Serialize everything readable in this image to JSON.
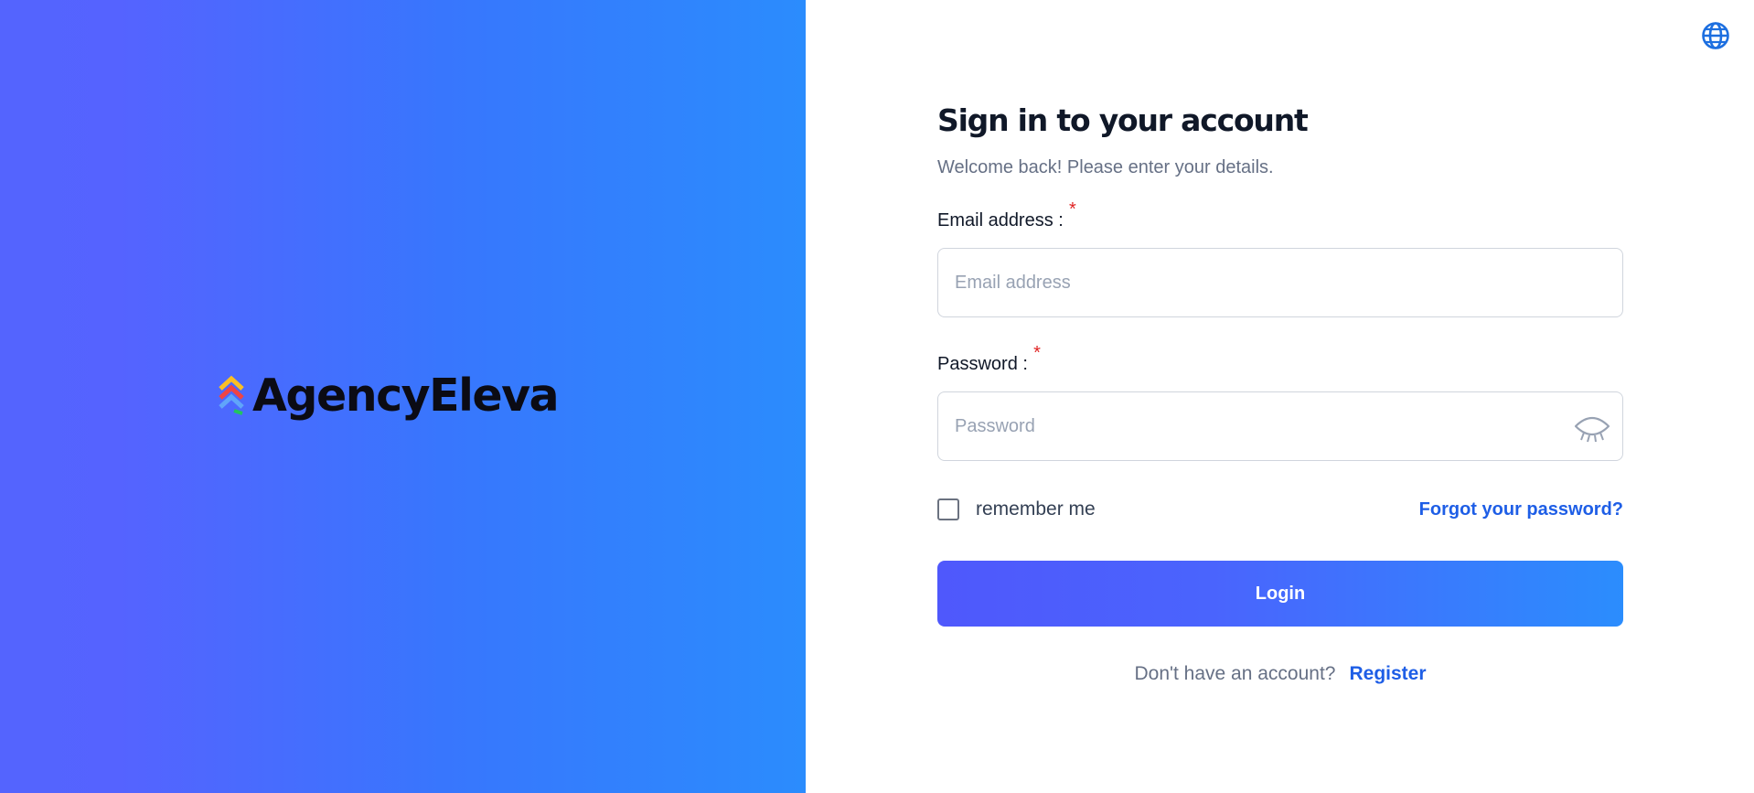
{
  "brand": {
    "name": "AgencyEleva",
    "logo_icon": "stacked-chevrons-logo",
    "logo_colors": [
      "#fbbf24",
      "#ef4444",
      "#60a5fa",
      "#22c55e"
    ]
  },
  "language": {
    "icon": "globe-icon"
  },
  "form": {
    "title": "Sign in to your account",
    "subtitle": "Welcome back! Please enter your details.",
    "email": {
      "label": "Email address :",
      "required_mark": "*",
      "placeholder": "Email address",
      "value": ""
    },
    "password": {
      "label": "Password :",
      "required_mark": "*",
      "placeholder": "Password",
      "value": "",
      "toggle_icon": "eye-closed-icon"
    },
    "remember_label": "remember me",
    "remember_checked": false,
    "forgot_label": "Forgot your password?",
    "login_label": "Login",
    "no_account_text": "Don't have an account?",
    "register_label": "Register"
  },
  "colors": {
    "accent": "#4f58fc",
    "link": "#1e5ee6",
    "required": "#e02424"
  }
}
